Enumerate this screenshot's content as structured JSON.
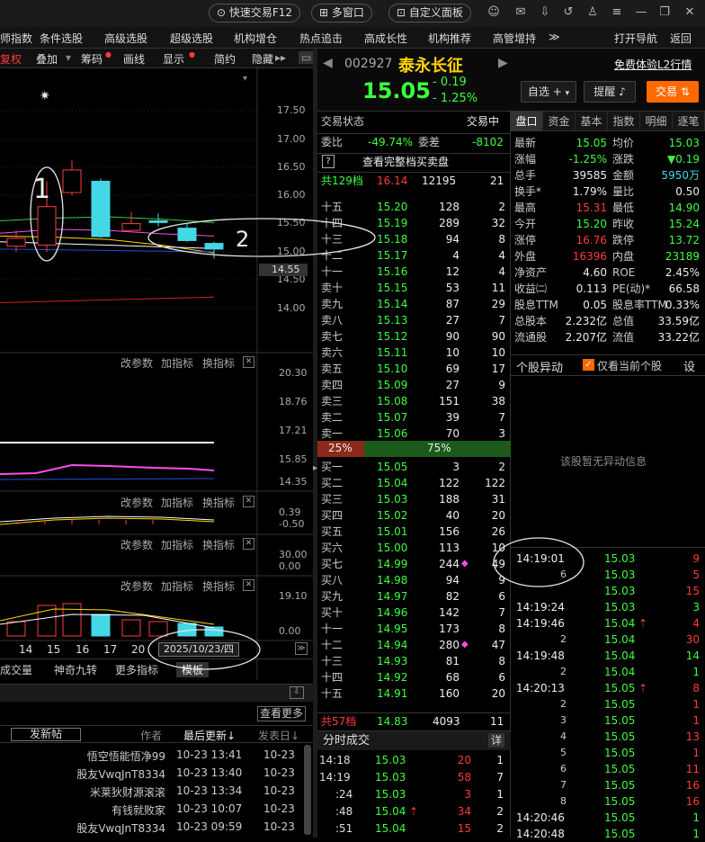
{
  "topbar": {
    "quick_trade": "快速交易F12",
    "multi_window": "多窗口",
    "custom_panel": "自定义面板"
  },
  "menu": [
    "师指数",
    "条件选股",
    "高级选股",
    "超级选股",
    "机构增仓",
    "热点追击",
    "高成长性",
    "机构推荐",
    "高管增持",
    "≫",
    "打开导航",
    "返回"
  ],
  "toolbar": {
    "items": [
      "复权",
      "叠加",
      "筹码",
      "画线",
      "显示",
      "简约",
      "隐藏"
    ],
    "ma_setting": "设置均线"
  },
  "chart": {
    "price_ticks": [
      "17.50",
      "17.00",
      "16.50",
      "16.00",
      "15.50",
      "15.00",
      "14.50",
      "14.00"
    ],
    "current_price_tag": "14.55",
    "marker_star": "✷",
    "annot1": "1",
    "annot2": "2",
    "x_labels": [
      "14",
      "15",
      "16",
      "17",
      "20"
    ],
    "date_box": "2025/10/23/四",
    "tabs": [
      "成交量",
      "神奇九转",
      "更多指标",
      "模板"
    ]
  },
  "candles": [
    {
      "o": 15.1,
      "h": 15.38,
      "l": 15.0,
      "c": 15.24
    },
    {
      "o": 15.12,
      "h": 16.25,
      "l": 15.0,
      "c": 15.8
    },
    {
      "o": 16.05,
      "h": 16.62,
      "l": 16.0,
      "c": 16.45
    },
    {
      "o": 16.25,
      "h": 16.3,
      "l": 15.25,
      "c": 15.27
    },
    {
      "o": 15.38,
      "h": 15.7,
      "l": 15.35,
      "c": 15.5
    },
    {
      "o": 15.55,
      "h": 15.68,
      "l": 15.45,
      "c": 15.52
    },
    {
      "o": 15.42,
      "h": 15.5,
      "l": 15.18,
      "c": 15.2
    },
    {
      "o": 15.15,
      "h": 15.18,
      "l": 14.88,
      "c": 15.05
    }
  ],
  "sub1": {
    "params": [
      "改参数",
      "加指标",
      "换指标"
    ],
    "ticks": [
      "20.30",
      "18.76",
      "17.21",
      "15.85",
      "14.35"
    ]
  },
  "sub2": {
    "params": [
      "改参数",
      "加指标",
      "换指标"
    ],
    "ticks": [
      "0.39",
      "-0.50"
    ]
  },
  "sub3": {
    "params": [
      "改参数",
      "加指标",
      "换指标"
    ],
    "ticks": [
      "30.00",
      "0.00"
    ]
  },
  "sub4": {
    "params": [
      "改参数",
      "加指标",
      "换指标"
    ],
    "ticks": [
      "19.10",
      "0.00"
    ]
  },
  "volume_bars": [
    {
      "v": 8,
      "dir": "up"
    },
    {
      "v": 17,
      "dir": "up"
    },
    {
      "v": 18,
      "dir": "up"
    },
    {
      "v": 12,
      "dir": "down"
    },
    {
      "v": 9,
      "dir": "up"
    },
    {
      "v": 8,
      "dir": "up"
    },
    {
      "v": 7,
      "dir": "down"
    },
    {
      "v": 5,
      "dir": "down"
    }
  ],
  "forum": {
    "btn_more": "查看更多",
    "new_post": "发新帖",
    "col_author": "作者",
    "col_update": "最后更新↓",
    "col_post": "发表日↓",
    "rows": [
      [
        "悟空悟能悟净99",
        "10-23 13:41",
        "10-23"
      ],
      [
        "股友VwqJnT8334",
        "10-23 13:40",
        "10-23"
      ],
      [
        "米莱狄财源滚滚",
        "10-23 13:34",
        "10-23"
      ],
      [
        "有钱就败家",
        "10-23 10:07",
        "10-23"
      ],
      [
        "股友VwqJnT8334",
        "10-23 09:59",
        "10-23"
      ]
    ]
  },
  "stock": {
    "code": "002927",
    "name": "泰永长征",
    "price": "15.05",
    "change": "- 0.19",
    "pct": "- 1.25%",
    "btn_watch": "自选",
    "btn_remind": "提醒",
    "btn_trade": "交易",
    "free_l2": "免费体验L2行情"
  },
  "depth": {
    "status_label": "交易状态",
    "status": "交易中",
    "ratio_label": "委比",
    "ratio": "-49.74%",
    "diff_label": "委差",
    "diff": "-8102",
    "full_label": "查看完整档买卖盘",
    "q": "?",
    "ask_total": {
      "label": "共129档",
      "price": "16.14",
      "vol": "12195",
      "num": "21"
    },
    "asks": [
      [
        "十五",
        "15.20",
        "128",
        "2"
      ],
      [
        "十四",
        "15.19",
        "289",
        "32"
      ],
      [
        "十三",
        "15.18",
        "94",
        "8"
      ],
      [
        "十二",
        "15.17",
        "4",
        "4"
      ],
      [
        "十一",
        "15.16",
        "12",
        "4"
      ],
      [
        "卖十",
        "15.15",
        "53",
        "11"
      ],
      [
        "卖九",
        "15.14",
        "87",
        "29"
      ],
      [
        "卖八",
        "15.13",
        "27",
        "7"
      ],
      [
        "卖七",
        "15.12",
        "90",
        "90"
      ],
      [
        "卖六",
        "15.11",
        "10",
        "10"
      ],
      [
        "卖五",
        "15.10",
        "69",
        "17"
      ],
      [
        "卖四",
        "15.09",
        "27",
        "9"
      ],
      [
        "卖三",
        "15.08",
        "151",
        "38"
      ],
      [
        "卖二",
        "15.07",
        "39",
        "7"
      ],
      [
        "卖一",
        "15.06",
        "70",
        "3"
      ]
    ],
    "buy_pct": "25%",
    "sell_pct": "75%",
    "bids": [
      [
        "买一",
        "15.05",
        "3",
        "2"
      ],
      [
        "买二",
        "15.04",
        "122",
        "122"
      ],
      [
        "买三",
        "15.03",
        "188",
        "31"
      ],
      [
        "买四",
        "15.02",
        "40",
        "20"
      ],
      [
        "买五",
        "15.01",
        "156",
        "26"
      ],
      [
        "买六",
        "15.00",
        "113",
        "10"
      ],
      [
        "买七",
        "14.99",
        "244",
        "49"
      ],
      [
        "买八",
        "14.98",
        "94",
        "9"
      ],
      [
        "买九",
        "14.97",
        "82",
        "6"
      ],
      [
        "买十",
        "14.96",
        "142",
        "7"
      ],
      [
        "十一",
        "14.95",
        "173",
        "8"
      ],
      [
        "十二",
        "14.94",
        "280",
        "47"
      ],
      [
        "十三",
        "14.93",
        "81",
        "8"
      ],
      [
        "十四",
        "14.92",
        "68",
        "6"
      ],
      [
        "十五",
        "14.91",
        "160",
        "20"
      ]
    ],
    "bid_total": {
      "label": "共57档",
      "price": "14.83",
      "vol": "4093",
      "num": "11"
    }
  },
  "ticks_left": {
    "title": "分时成交",
    "detail": "详",
    "rows": [
      [
        "14:18",
        "15.03",
        "20",
        "1"
      ],
      [
        "14:19",
        "15.03",
        "58",
        "7"
      ],
      [
        ":24",
        "15.03",
        "3",
        "1"
      ],
      [
        ":48",
        "15.04",
        "34",
        "2"
      ],
      [
        ":51",
        "15.04",
        "15",
        "2"
      ]
    ]
  },
  "quote": {
    "tabs": [
      "盘口",
      "资金",
      "基本",
      "指数",
      "明细",
      "逐笔"
    ],
    "rows": [
      [
        "最新",
        "15.05",
        "均价",
        "15.03"
      ],
      [
        "涨幅",
        "-1.25%",
        "涨跌",
        "▼0.19"
      ],
      [
        "总手",
        "39585",
        "金额",
        "5950万"
      ],
      [
        "换手*",
        "1.79%",
        "量比",
        "0.50"
      ],
      [
        "最高",
        "15.31",
        "最低",
        "14.90"
      ],
      [
        "今开",
        "15.20",
        "昨收",
        "15.24"
      ],
      [
        "涨停",
        "16.76",
        "跌停",
        "13.72"
      ],
      [
        "外盘",
        "16396",
        "内盘",
        "23189"
      ],
      [
        "净资产",
        "4.60",
        "ROE",
        "2.45%"
      ],
      [
        "收益㈡",
        "0.113",
        "PE(动)*",
        "66.58"
      ],
      [
        "股息TTM",
        "0.05",
        "股息率TTM",
        "0.33%"
      ],
      [
        "总股本",
        "2.232亿",
        "总值",
        "33.59亿"
      ],
      [
        "流通股",
        "2.207亿",
        "流值",
        "33.22亿"
      ]
    ]
  },
  "anomaly": {
    "title": "个股异动",
    "only_current": "仅看当前个股",
    "settings": "设",
    "empty": "该股暂无异动信息"
  },
  "ticks_right": [
    [
      "14:19:01",
      "15.03",
      "9"
    ],
    [
      "6",
      "15.03",
      "5"
    ],
    [
      "",
      "15.03",
      "15"
    ],
    [
      "14:19:24",
      "15.03",
      "3"
    ],
    [
      "14:19:46",
      "15.04",
      "4"
    ],
    [
      "2",
      "15.04",
      "30"
    ],
    [
      "14:19:48",
      "15.04",
      "14"
    ],
    [
      "2",
      "15.04",
      "1"
    ],
    [
      "14:20:13",
      "15.05",
      "8"
    ],
    [
      "2",
      "15.05",
      "1"
    ],
    [
      "3",
      "15.05",
      "1"
    ],
    [
      "4",
      "15.05",
      "13"
    ],
    [
      "5",
      "15.05",
      "1"
    ],
    [
      "6",
      "15.05",
      "11"
    ],
    [
      "7",
      "15.05",
      "16"
    ],
    [
      "8",
      "15.05",
      "16"
    ],
    [
      "14:20:46",
      "15.05",
      "1"
    ],
    [
      "14:20:48",
      "15.05",
      "1"
    ]
  ],
  "colors": {
    "up": "#ff3b3b",
    "down": "#3dff3d",
    "cyan": "#43d8e6",
    "accent": "#ff6a00"
  }
}
